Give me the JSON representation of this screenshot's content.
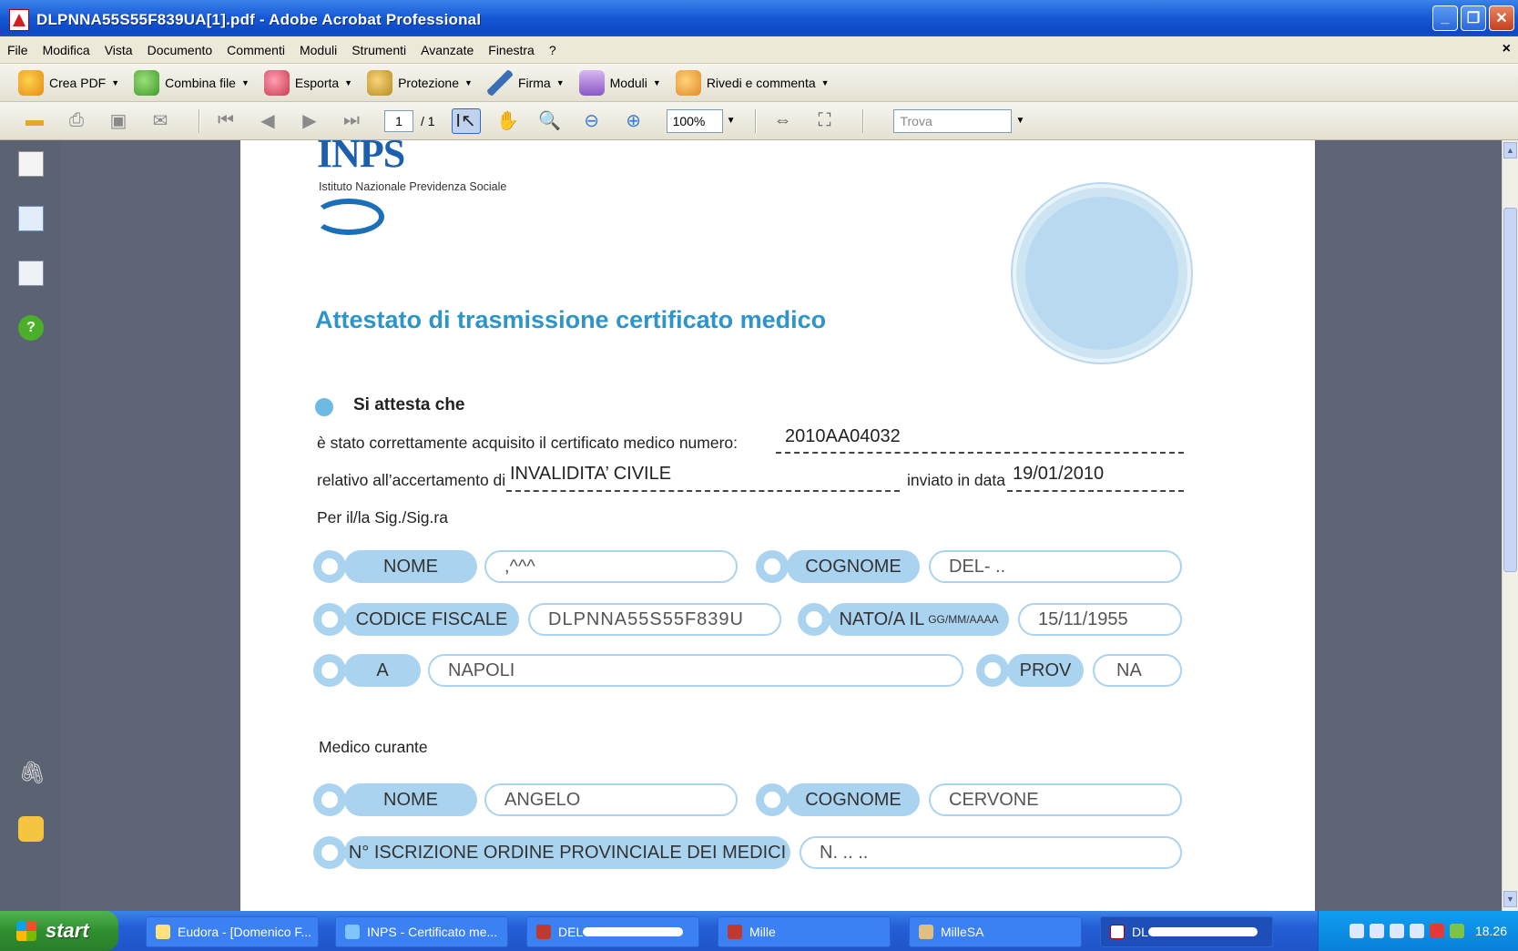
{
  "window": {
    "title": "DLPNNA55S55F839UA[1].pdf - Adobe Acrobat Professional",
    "controls": [
      "_",
      "❐",
      "✕"
    ]
  },
  "menu": [
    "File",
    "Modifica",
    "Vista",
    "Documento",
    "Commenti",
    "Moduli",
    "Strumenti",
    "Avanzate",
    "Finestra",
    "?"
  ],
  "menu_close": "×",
  "toolbar1": [
    {
      "label": "Crea PDF",
      "icon": "create-pdf-icon"
    },
    {
      "label": "Combina file",
      "icon": "combine-files-icon"
    },
    {
      "label": "Esporta",
      "icon": "export-icon"
    },
    {
      "label": "Protezione",
      "icon": "lock-icon"
    },
    {
      "label": "Firma",
      "icon": "pen-icon"
    },
    {
      "label": "Moduli",
      "icon": "forms-icon"
    },
    {
      "label": "Rivedi e commenta",
      "icon": "comment-icon"
    }
  ],
  "toolbar2": {
    "page_current": "1",
    "page_total": "/ 1",
    "zoom": "100%",
    "find_placeholder": "Trova"
  },
  "colors": {
    "accent": "#2e95c9",
    "pill": "#a9d3ef",
    "titlebar": "#1658d6"
  },
  "document": {
    "logo_text": "INPS",
    "logo_subtitle": "Istituto Nazionale Previdenza Sociale",
    "title": "Attestato di trasmissione certificato medico",
    "si_attesta": "Si attesta che",
    "line1_label": "è stato correttamente acquisito il certificato medico numero:",
    "certificate_number": "2010AA04032",
    "line2_label": "relativo all’accertamento di",
    "accertamento": "INVALIDITA’ CIVILE",
    "inviato_label": "inviato in data",
    "inviato_date": "19/01/2010",
    "per_label": "Per il/la Sig./Sig.ra",
    "patient": {
      "nome_label": "NOME",
      "nome_value": ",^^^",
      "cognome_label": "COGNOME",
      "cognome_value": "DEL-   ..",
      "cf_label": "CODICE FISCALE",
      "cf_value": "DLPNNA55S55F839U",
      "nato_label": "NATO/A IL",
      "nato_format": "GG/MM/AAAA",
      "nato_value": "15/11/1955",
      "a_label": "A",
      "a_value": "NAPOLI",
      "prov_label": "PROV",
      "prov_value": "NA"
    },
    "medico_label": "Medico curante",
    "doctor": {
      "nome_label": "NOME",
      "nome_value": "ANGELO",
      "cognome_label": "COGNOME",
      "cognome_value": "CERVONE",
      "iscrizione_label": "N° ISCRIZIONE ORDINE PROVINCIALE DEI MEDICI",
      "iscrizione_value": "N.  ..  .."
    }
  },
  "taskbar": {
    "start": "start",
    "tasks": [
      "Eudora - [Domenico F...",
      "INPS - Certificato me...",
      "DEL",
      "Mille",
      "MilleSA",
      "DL"
    ],
    "clock": "18.26"
  }
}
